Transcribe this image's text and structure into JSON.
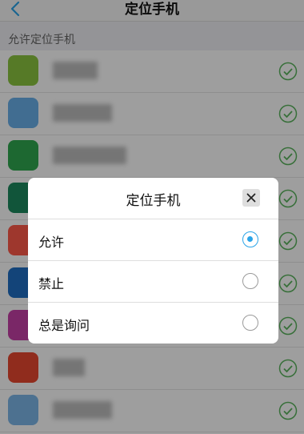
{
  "nav": {
    "title": "定位手机",
    "back_icon": "chevron-left-icon"
  },
  "section": {
    "title": "允许定位手机"
  },
  "apps": [
    {
      "icon_color": "#8cc63f",
      "checked": true
    },
    {
      "icon_color": "#6ab0ea",
      "checked": true
    },
    {
      "icon_color": "#2fa84f",
      "checked": true
    },
    {
      "icon_color": "#1c8a5e",
      "checked": true
    },
    {
      "icon_color": "#ff5a4a",
      "checked": true
    },
    {
      "icon_color": "#1f6fc4",
      "checked": true
    },
    {
      "icon_color": "#c63fa6",
      "checked": true
    },
    {
      "icon_color": "#e8482f",
      "checked": true
    },
    {
      "icon_color": "#7db7e8",
      "checked": true
    }
  ],
  "dialog": {
    "title": "定位手机",
    "close_icon": "close-icon",
    "options": [
      {
        "label": "允许",
        "selected": true
      },
      {
        "label": "禁止",
        "selected": false
      },
      {
        "label": "总是询问",
        "selected": false
      }
    ]
  },
  "colors": {
    "accent": "#2aa4e8",
    "check": "#59b45c"
  }
}
